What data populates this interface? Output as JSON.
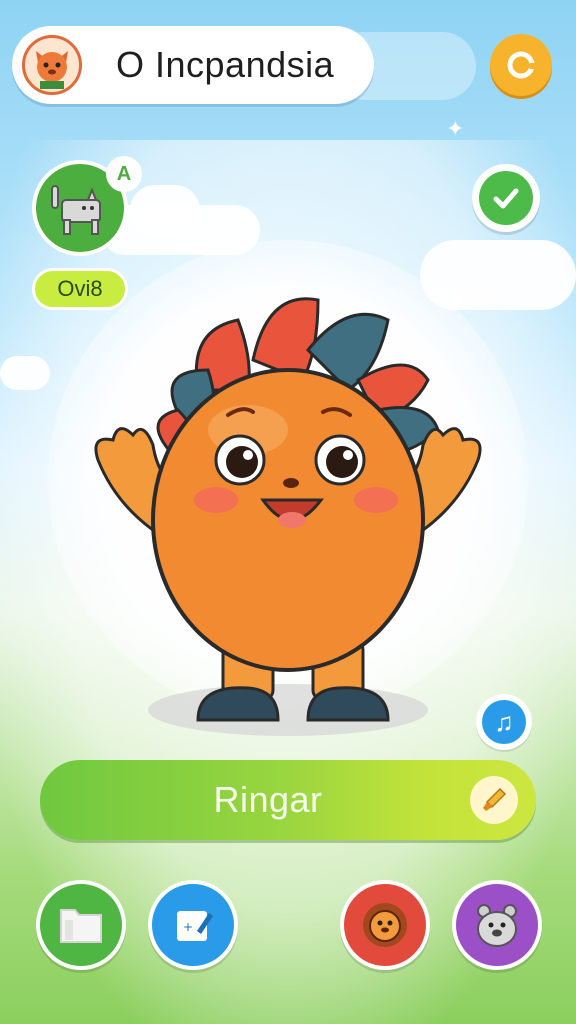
{
  "header": {
    "player_name": "O Incpandsia",
    "avatar_icon": "fox-avatar-icon",
    "settings_icon": "settings-icon"
  },
  "pet_card": {
    "letter": "A",
    "tag_label": "Ovi8",
    "pet_icon": "cat-icon"
  },
  "confirm": {
    "icon": "check-icon"
  },
  "music": {
    "icon": "music-note-icon",
    "glyph": "♫"
  },
  "action_bar": {
    "label": "Ringar",
    "edit_icon": "brush-icon"
  },
  "bottom_nav": [
    {
      "icon": "folder-icon",
      "color": "#4fb543"
    },
    {
      "icon": "edit-card-icon",
      "color": "#2a9be8"
    },
    {
      "icon": "lion-icon",
      "color": "#e24b3b"
    },
    {
      "icon": "bear-icon",
      "color": "#9b50c8"
    }
  ],
  "colors": {
    "accent_orange": "#f7b32b",
    "accent_green": "#4cae3f",
    "bar_green": "#8fd23f",
    "sky_blue": "#8fd3f4"
  }
}
